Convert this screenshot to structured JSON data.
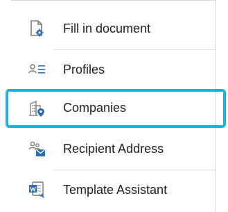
{
  "menu": {
    "items": [
      {
        "label": "Fill in document",
        "icon": "document-gear-icon"
      },
      {
        "label": "Profiles",
        "icon": "profiles-icon"
      },
      {
        "label": "Companies",
        "icon": "company-building-icon"
      },
      {
        "label": "Recipient Address",
        "icon": "recipient-address-icon"
      },
      {
        "label": "Template Assistant",
        "icon": "template-assistant-icon"
      }
    ],
    "selected_index": 2,
    "colors": {
      "highlight_border": "#1bb5e0",
      "icon_blue": "#2b6cb7",
      "icon_gray": "#7a7a7a",
      "text": "#1f1f1f"
    }
  }
}
